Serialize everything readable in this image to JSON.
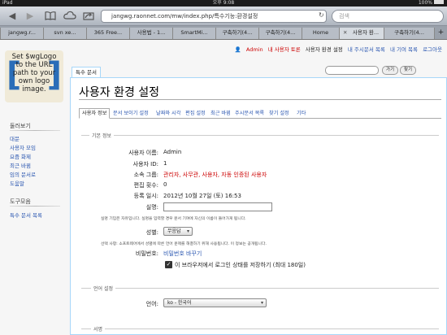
{
  "status": {
    "carrier": "iPad",
    "time": "오후 9:08",
    "battery": "100%"
  },
  "browser": {
    "url": "jangwg.raonnet.com/mw/index.php/특수기능:환경설정",
    "search_placeholder": "검색",
    "tabs": [
      {
        "label": "jangwg.r..."
      },
      {
        "label": "svn xe..."
      },
      {
        "label": "365 Free..."
      },
      {
        "label": "사용법 - 1..."
      },
      {
        "label": "SmartMi..."
      },
      {
        "label": "구축하기(4..."
      },
      {
        "label": "구축하기(4..."
      },
      {
        "label": "Home"
      },
      {
        "label": "사용자 환..."
      },
      {
        "label": "구축하기(4..."
      }
    ],
    "add_tab": "+"
  },
  "logo": {
    "text": "Set $wgLogo to the URL path to your own logo image."
  },
  "personal": {
    "user": "Admin",
    "talk": "내 사용자 토론",
    "prefs": "사용자 환경 설정",
    "watchlist": "내 주시문서 목록",
    "contribs": "내 기여 목록",
    "logout": "로그아웃"
  },
  "content_tab": "특수 문서",
  "search": {
    "go": "가기",
    "search": "찾기"
  },
  "page_title": "사용자 환경 설정",
  "pref_tabs": [
    "사용자 정보",
    "문서 보이기 설정",
    "날짜와 시각",
    "편집 설정",
    "최근 바뀜",
    "주시문서 목록",
    "찾기 설정",
    "기타"
  ],
  "sidebar": {
    "heading1": "둘러보기",
    "nav": [
      "대문",
      "사용자 모임",
      "요즘 화제",
      "최근 바뀜",
      "임의 문서로",
      "도움말"
    ],
    "heading2": "도구모음",
    "tools": [
      "특수 문서 목록"
    ]
  },
  "basic": {
    "legend": "기본 정보",
    "username_label": "사용자 이름:",
    "username": "Admin",
    "userid_label": "사용자 ID:",
    "userid": "1",
    "groups_label": "소속 그룹:",
    "groups": "관리자, 사무관, 사용자, 자동 인증된 사용자",
    "edits_label": "편집 횟수:",
    "edits": "0",
    "registered_label": "등록 일시:",
    "registered": "2012년 10월 27일 (토) 16:53",
    "realname_label": "실명:",
    "realname_note": "실명 기입은 자유입니다. 실명을 입력할 경우 문서 기여에 자신의 이름이 들어가게 됩니다.",
    "gender_label": "성별:",
    "gender_value": "무응답",
    "gender_note": "선택 사항: 소프트웨어에서 성별에 따른 언어 문제를 해결하기 위해 사용됩니다. 이 정보는 공개됩니다.",
    "password_label": "비밀번호:",
    "password_link": "비밀번호 바꾸기",
    "remember": "이 브라우저에서 로그인 상태를 저장하기 (최대 180일)"
  },
  "language": {
    "legend": "언어 설정",
    "label": "언어:",
    "value": "ko - 한국어"
  },
  "signature": {
    "legend": "서명"
  }
}
